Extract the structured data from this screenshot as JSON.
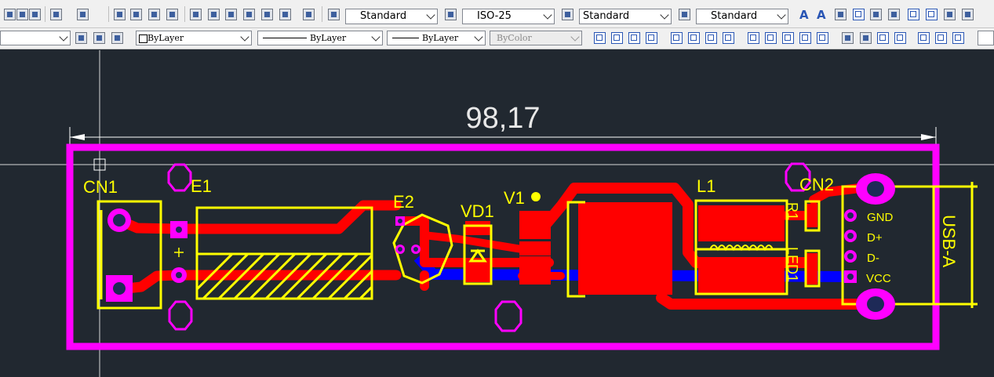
{
  "toolbar1": {
    "text_style": "Standard",
    "dim_style": "ISO-25",
    "table_style": "Standard",
    "multileader_style": "Standard",
    "icons": [
      "new-icon",
      "open-icon",
      "save-icon",
      "publish-icon",
      "undo-icon",
      "redo-icon",
      "pan-icon",
      "zoom-realtime-icon",
      "zoom-window-icon",
      "zoom-previous-icon",
      "properties-icon",
      "design-center-icon",
      "tool-palettes-icon",
      "markup-icon",
      "quickcalc-icon",
      "calculator-icon",
      "help-icon",
      "text-style-icon",
      "dim-style-icon",
      "table-style-icon",
      "multileader-style-icon",
      "multiline-text-icon",
      "single-line-text-icon",
      "edit-text-icon",
      "find-text-icon",
      "spell-check-icon",
      "scale-text-icon",
      "justify-text-icon",
      "convert-icon"
    ]
  },
  "toolbar2": {
    "layer_color": "ByLayer",
    "linetype": "ByLayer",
    "lineweight": "ByLayer",
    "plot_style": "ByColor",
    "icons": [
      "layer-states-icon",
      "make-current-icon",
      "layer-previous-icon",
      "linear-dim-icon",
      "aligned-dim-icon",
      "arc-length-icon",
      "ordinate-icon",
      "radius-icon",
      "jogged-icon",
      "diameter-icon",
      "angular-icon",
      "quick-dim-icon",
      "baseline-icon",
      "continue-icon",
      "dim-space-icon",
      "dim-break-icon",
      "tolerance-icon",
      "center-mark-icon",
      "inspect-icon",
      "jogged-linear-icon",
      "dim-edit-icon",
      "dim-text-edit-icon",
      "dim-update-icon"
    ]
  },
  "drawing": {
    "dimension_value": "98,17",
    "labels": {
      "cn1": "CN1",
      "e1": "E1",
      "e2": "E2",
      "vd1": "VD1",
      "v1": "V1",
      "l1": "L1",
      "cn2": "CN2",
      "r1": "R1",
      "led1": "LED1",
      "gnd": "GND",
      "dplus": "D+",
      "dminus": "D-",
      "vcc": "VCC",
      "usb": "USB-A"
    },
    "colors": {
      "background": "#212830",
      "outline": "#ff00ff",
      "copper_top": "#ff0000",
      "copper_bottom": "#0000ff",
      "silkscreen": "#ffff00",
      "pad": "#ff00ff",
      "dimension": "#ffffff"
    }
  }
}
